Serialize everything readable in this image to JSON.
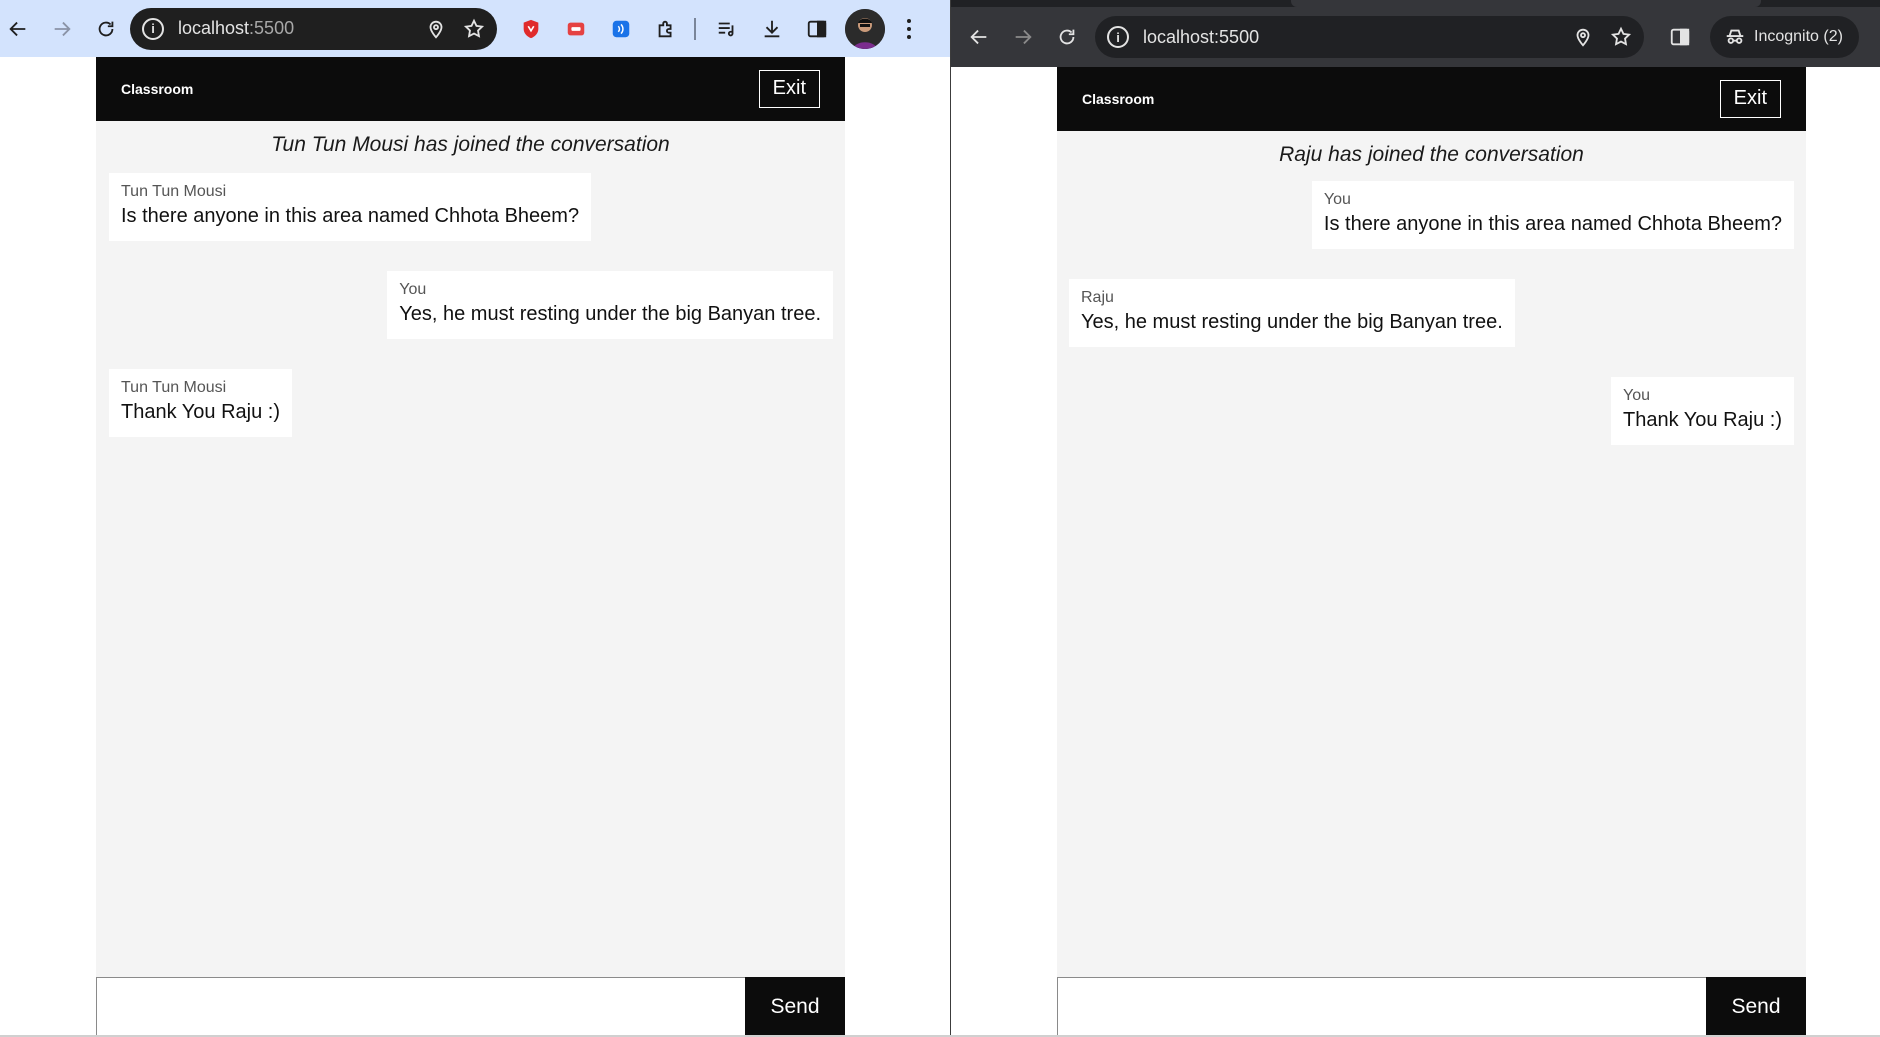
{
  "left_window": {
    "browser": {
      "url_host": "localhost",
      "url_port": ":5500"
    },
    "app": {
      "title": "Classroom",
      "exit_label": "Exit",
      "join_message": "Tun Tun Mousi has joined the conversation",
      "messages": [
        {
          "sender": "Tun Tun Mousi",
          "text": "Is there anyone in this area named Chhota Bheem?",
          "side": "left"
        },
        {
          "sender": "You",
          "text": "Yes, he must resting under the big Banyan tree.",
          "side": "right"
        },
        {
          "sender": "Tun Tun Mousi",
          "text": "Thank You Raju :)",
          "side": "left"
        }
      ],
      "input_value": "",
      "send_label": "Send"
    }
  },
  "right_window": {
    "browser": {
      "url_host": "localhost",
      "url_port": ":5500",
      "incognito_label": "Incognito (2)"
    },
    "app": {
      "title": "Classroom",
      "exit_label": "Exit",
      "join_message": "Raju has joined the conversation",
      "messages": [
        {
          "sender": "You",
          "text": "Is there anyone in this area named Chhota Bheem?",
          "side": "right"
        },
        {
          "sender": "Raju",
          "text": "Yes, he must resting under the big Banyan tree.",
          "side": "left"
        },
        {
          "sender": "You",
          "text": "Thank You Raju :)",
          "side": "right"
        }
      ],
      "input_value": "",
      "send_label": "Send"
    }
  },
  "colors": {
    "header_bg": "#0c0c0c",
    "chat_bg": "#f4f4f4",
    "bubble_bg": "#ffffff",
    "light_toolbar": "#d3e3fd",
    "dark_toolbar": "#35363a"
  }
}
